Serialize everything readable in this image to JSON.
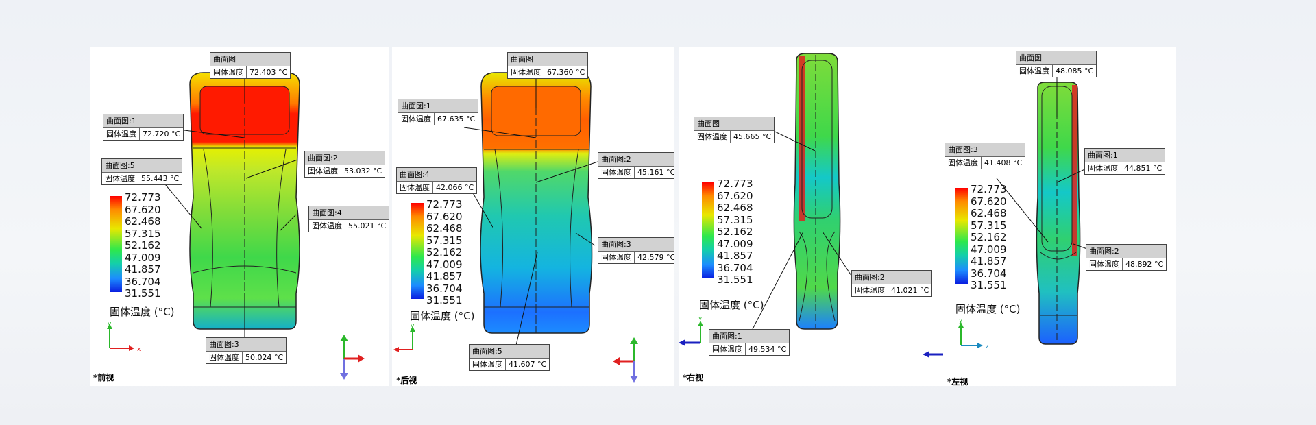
{
  "legend": {
    "values": [
      "72.773",
      "67.620",
      "62.468",
      "57.315",
      "52.162",
      "47.009",
      "41.857",
      "36.704",
      "31.551"
    ],
    "unit_label": "固体温度 (°C)"
  },
  "panels": [
    {
      "view_label": "*前视",
      "callouts": [
        {
          "title": "曲面图",
          "field": "固体温度",
          "value": "72.403 °C"
        },
        {
          "title": "曲面图:1",
          "field": "固体温度",
          "value": "72.720 °C"
        },
        {
          "title": "曲面图:5",
          "field": "固体温度",
          "value": "55.443 °C"
        },
        {
          "title": "曲面图:2",
          "field": "固体温度",
          "value": "53.032 °C"
        },
        {
          "title": "曲面图:4",
          "field": "固体温度",
          "value": "55.021 °C"
        },
        {
          "title": "曲面图:3",
          "field": "固体温度",
          "value": "50.024 °C"
        }
      ],
      "axis_labels": {
        "x": "x",
        "y": "y"
      }
    },
    {
      "view_label": "*后视",
      "callouts": [
        {
          "title": "曲面图",
          "field": "固体温度",
          "value": "67.360 °C"
        },
        {
          "title": "曲面图:1",
          "field": "固体温度",
          "value": "67.635 °C"
        },
        {
          "title": "曲面图:4",
          "field": "固体温度",
          "value": "42.066 °C"
        },
        {
          "title": "曲面图:2",
          "field": "固体温度",
          "value": "45.161 °C"
        },
        {
          "title": "曲面图:3",
          "field": "固体温度",
          "value": "42.579 °C"
        },
        {
          "title": "曲面图:5",
          "field": "固体温度",
          "value": "41.607 °C"
        }
      ],
      "axis_labels": {
        "x": "",
        "y": "y"
      }
    },
    {
      "view_label": "*右视",
      "callouts": [
        {
          "title": "曲面图",
          "field": "固体温度",
          "value": "45.665 °C"
        },
        {
          "title": "曲面图:2",
          "field": "固体温度",
          "value": "41.021 °C"
        },
        {
          "title": "曲面图:1",
          "field": "固体温度",
          "value": "49.534 °C"
        }
      ],
      "axis_labels": {
        "x": "",
        "y": "y"
      }
    },
    {
      "view_label": "*左视",
      "callouts": [
        {
          "title": "曲面图",
          "field": "固体温度",
          "value": "48.085 °C"
        },
        {
          "title": "曲面图:3",
          "field": "固体温度",
          "value": "41.408 °C"
        },
        {
          "title": "曲面图:1",
          "field": "固体温度",
          "value": "44.851 °C"
        },
        {
          "title": "曲面图:2",
          "field": "固体温度",
          "value": "48.892 °C"
        }
      ],
      "axis_labels": {
        "x": "z",
        "y": "y"
      }
    }
  ],
  "colors": {
    "hot": "#ff0000",
    "warm": "#e8e800",
    "mid": "#2ee84c",
    "cool": "#14c8d8",
    "cold": "#1c5cff"
  }
}
